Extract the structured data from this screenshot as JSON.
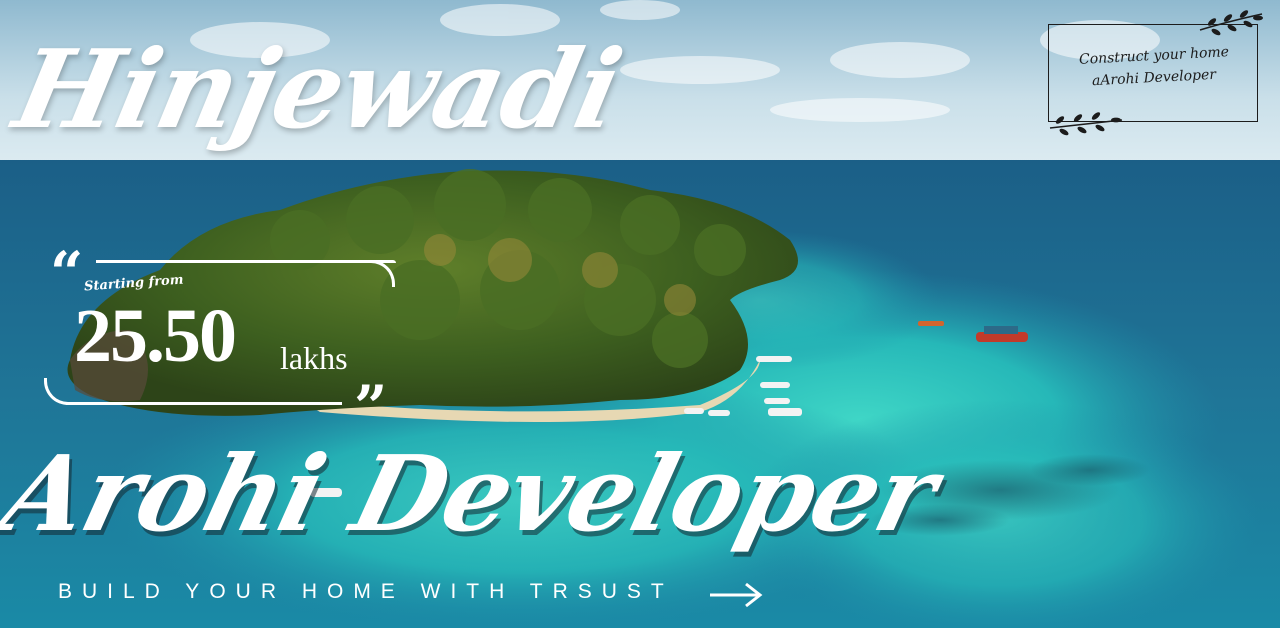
{
  "banner": {
    "location": "Hinjewadi",
    "price": {
      "label": "Starting from",
      "amount": "25.50",
      "unit": "lakhs",
      "quote_open": "“",
      "quote_close": "”"
    },
    "brand": "Arohi Developer",
    "tagline": "BUILD YOUR HOME WITH TRSUST",
    "cta_icon": "arrow-right-icon",
    "badge": {
      "line1": "Construct your home",
      "line2": "aArohi Developer",
      "ornament_icon": "leaf-sprig-icon"
    },
    "colors": {
      "text": "#ffffff",
      "sea_deep": "#1f6f95",
      "lagoon": "#2ec9c0",
      "island": "#3f6a22",
      "sky": "#cfe3ee"
    }
  }
}
